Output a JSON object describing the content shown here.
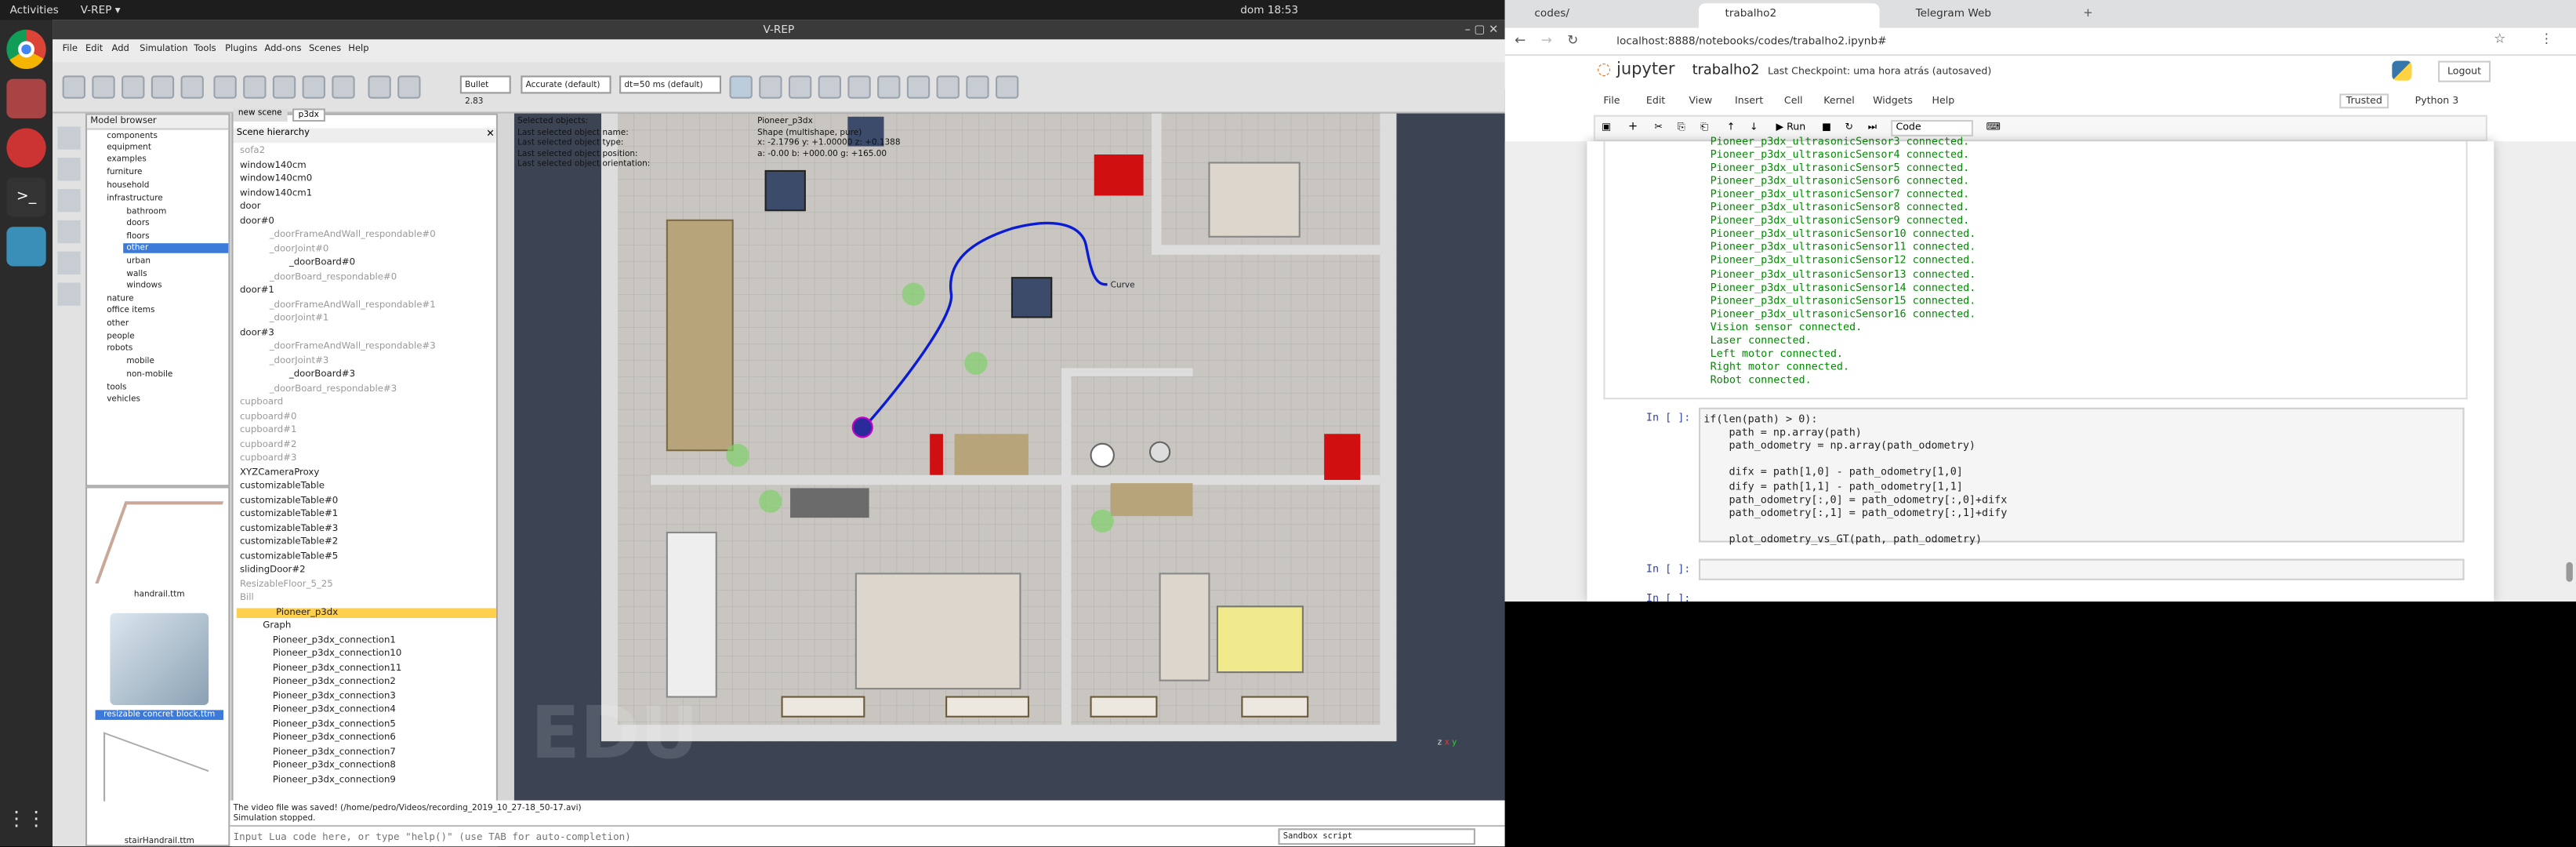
{
  "topbar": {
    "activities": "Activities",
    "app": "V-REP ▾",
    "clock": "dom 18:53"
  },
  "vrep": {
    "title": "V-REP",
    "menu": [
      "File",
      "Edit",
      "Add",
      "Simulation",
      "Tools",
      "Plugins",
      "Add-ons",
      "Scenes",
      "Help"
    ],
    "engine": "Bullet 2.83",
    "accuracy": "Accurate (default)",
    "dt": "dt=50 ms (default)",
    "model_browser": {
      "title": "Model browser",
      "items": [
        "components",
        "equipment",
        "examples",
        "furniture",
        "household",
        "infrastructure",
        "bathroom",
        "doors",
        "floors",
        "other",
        "urban",
        "walls",
        "windows",
        "nature",
        "office items",
        "other",
        "people",
        "robots",
        "mobile",
        "non-mobile",
        "tools",
        "vehicles"
      ]
    },
    "thumbs": [
      "handrail.ttm",
      "resizable concret block.ttm",
      "stairHandrail.ttm"
    ],
    "scene_tabs": [
      "new scene",
      "p3dx"
    ],
    "hier_title": "Scene hierarchy",
    "hier": [
      "sofa2",
      "window140cm",
      "window140cm0",
      "window140cm1",
      "door",
      "door#0",
      "_doorFrameAndWall_respondable#0",
      "_doorJoint#0",
      "_doorBoard#0",
      "_doorBoard_respondable#0",
      "door#1",
      "_doorFrameAndWall_respondable#1",
      "_doorJoint#1",
      "door#3",
      "_doorFrameAndWall_respondable#3",
      "_doorJoint#3",
      "_doorBoard#3",
      "_doorBoard_respondable#3",
      "cupboard",
      "cupboard#0",
      "cupboard#1",
      "cupboard#2",
      "cupboard#3",
      "XYZCameraProxy",
      "customizableTable",
      "customizableTable#0",
      "customizableTable#1",
      "customizableTable#3",
      "customizableTable#2",
      "customizableTable#5",
      "slidingDoor#2",
      "ResizableFloor_5_25",
      "Bill",
      "Pioneer_p3dx",
      "Graph",
      "Pioneer_p3dx_connection1",
      "Pioneer_p3dx_connection10",
      "Pioneer_p3dx_connection11",
      "Pioneer_p3dx_connection2",
      "Pioneer_p3dx_connection3",
      "Pioneer_p3dx_connection4",
      "Pioneer_p3dx_connection5",
      "Pioneer_p3dx_connection6",
      "Pioneer_p3dx_connection7",
      "Pioneer_p3dx_connection8",
      "Pioneer_p3dx_connection9"
    ],
    "info": [
      "Selected objects:",
      "Last selected object name:",
      "Last selected object type:",
      "Last selected object position:",
      "Last selected object orientation:"
    ],
    "info_vals": [
      "Pioneer_p3dx",
      "Shape (multishape, pure)",
      "x: -2.1796 y: +1.00000 z: +0.1388",
      "a: -0.00 b: +000.00 g: +165.00"
    ],
    "curve_label": "Curve",
    "edu": "EDU",
    "axes": [
      "z",
      "x",
      "y"
    ],
    "status": [
      "The video file was saved! (/home/pedro/Videos/recording_2019_10_27-18_50-17.avi)",
      "Simulation stopped."
    ],
    "cmd_placeholder": "Input Lua code here, or type \"help()\" (use TAB for auto-completion)",
    "sandbox": "Sandbox script"
  },
  "chrome": {
    "tabs": [
      "codes/",
      "trabalho2",
      "Telegram Web"
    ],
    "url": "localhost:8888/notebooks/codes/trabalho2.ipynb#",
    "jupyter": "jupyter",
    "nb_title": "trabalho2",
    "checkpoint": "Last Checkpoint: uma hora atrás",
    "autosaved": "(autosaved)",
    "logout": "Logout",
    "menu": [
      "File",
      "Edit",
      "View",
      "Insert",
      "Cell",
      "Kernel",
      "Widgets",
      "Help"
    ],
    "trusted": "Trusted",
    "kernel": "Python 3",
    "run": "Run",
    "celltype": "Code",
    "output": [
      "Pioneer_p3dx_ultrasonicSensor3 connected.",
      "Pioneer_p3dx_ultrasonicSensor4 connected.",
      "Pioneer_p3dx_ultrasonicSensor5 connected.",
      "Pioneer_p3dx_ultrasonicSensor6 connected.",
      "Pioneer_p3dx_ultrasonicSensor7 connected.",
      "Pioneer_p3dx_ultrasonicSensor8 connected.",
      "Pioneer_p3dx_ultrasonicSensor9 connected.",
      "Pioneer_p3dx_ultrasonicSensor10 connected.",
      "Pioneer_p3dx_ultrasonicSensor11 connected.",
      "Pioneer_p3dx_ultrasonicSensor12 connected.",
      "Pioneer_p3dx_ultrasonicSensor13 connected.",
      "Pioneer_p3dx_ultrasonicSensor14 connected.",
      "Pioneer_p3dx_ultrasonicSensor15 connected.",
      "Pioneer_p3dx_ultrasonicSensor16 connected.",
      "Vision sensor connected.",
      "Laser connected.",
      "Left motor connected.",
      "Right motor connected.",
      "Robot connected."
    ],
    "prompt": "In [ ]:",
    "code": [
      "if(len(path) > 0):",
      "    path = np.array(path)",
      "    path_odometry = np.array(path_odometry)",
      "",
      "    difx = path[1,0] - path_odometry[1,0]",
      "    dify = path[1,1] - path_odometry[1,1]",
      "    path_odometry[:,0] = path_odometry[:,0]+difx",
      "    path_odometry[:,1] = path_odometry[:,1]+dify",
      "",
      "    plot_odometry_vs_GT(path, path_odometry)"
    ]
  },
  "colors": {
    "jupyter_orange": "#f37726",
    "output_green": "#008b00",
    "selection": "#ffd04d",
    "path_blue": "#0a1bd6"
  }
}
